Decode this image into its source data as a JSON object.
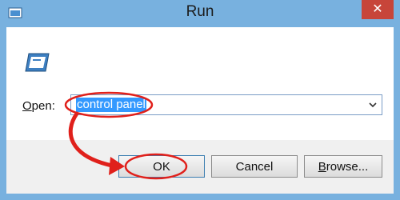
{
  "window": {
    "title": "Run",
    "close_glyph": "✕"
  },
  "dialog": {
    "open_label_mnemonic": "O",
    "open_label_rest": "pen:",
    "combo_value": "control panel"
  },
  "buttons": {
    "ok": "OK",
    "cancel": "Cancel",
    "browse_mnemonic": "B",
    "browse_rest": "rowse..."
  },
  "colors": {
    "frame": "#78b1df",
    "close": "#c7453a",
    "selection": "#3399ff",
    "annotation": "#e0201b"
  },
  "icons": [
    "app-icon",
    "close-icon",
    "run-icon",
    "dropdown-arrow-icon"
  ]
}
